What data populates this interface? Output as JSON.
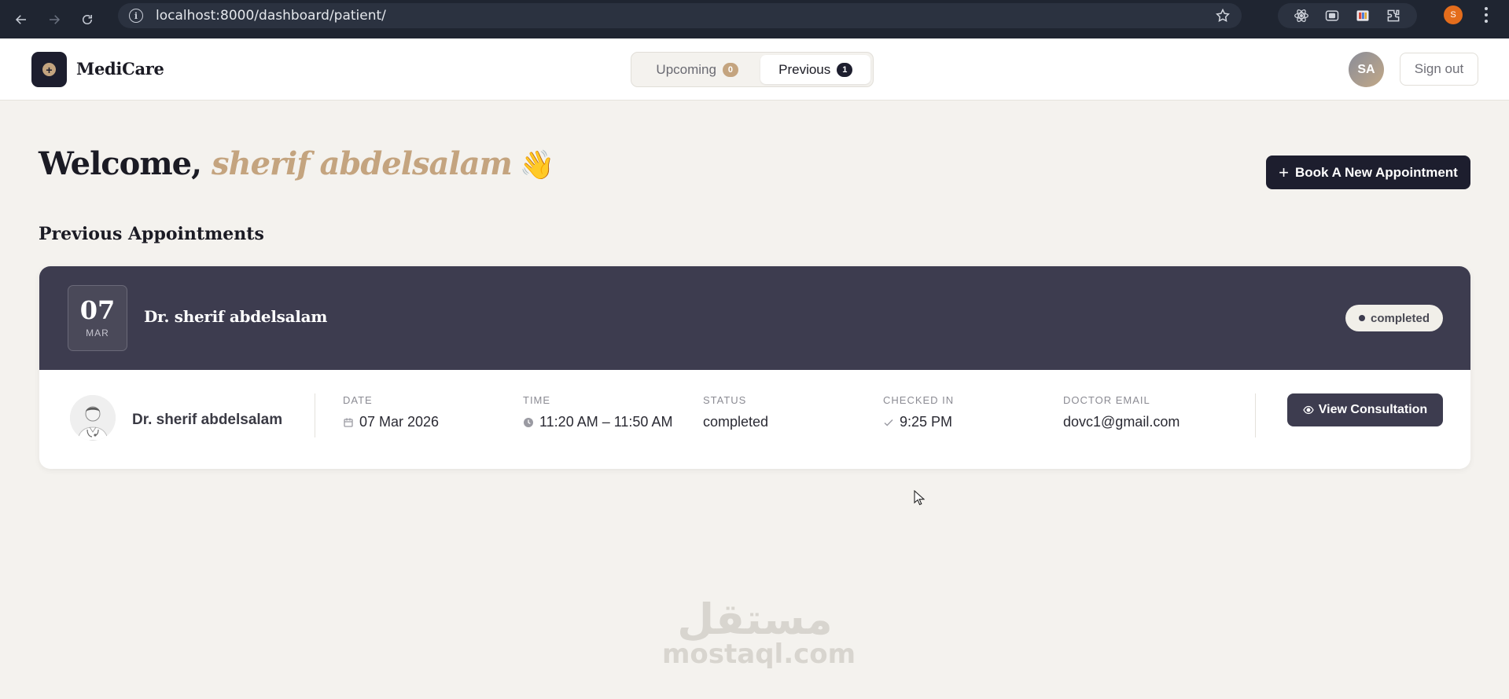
{
  "browser": {
    "url": "localhost:8000/dashboard/patient/",
    "profile_initial": "S",
    "icons": [
      "back-icon",
      "forward-icon",
      "reload-icon",
      "site-info-icon",
      "bookmark-star-icon",
      "react-devtools-icon",
      "screen-capture-icon",
      "extension-icon",
      "puzzle-icon",
      "menu-icon"
    ]
  },
  "header": {
    "brand": "MediCare",
    "tabs": [
      {
        "label": "Upcoming",
        "count": "0",
        "active": false
      },
      {
        "label": "Previous",
        "count": "1",
        "active": true
      }
    ],
    "avatar_initials": "SA",
    "signout_label": "Sign out"
  },
  "main": {
    "welcome_prefix": "Welcome,",
    "welcome_name": "sherif abdelsalam",
    "welcome_emoji": "👋",
    "book_button_label": "Book A New Appointment",
    "section_title": "Previous Appointments"
  },
  "appointment": {
    "day": "07",
    "month": "MAR",
    "doctor_name": "Dr. sherif abdelsalam",
    "status_badge": "completed",
    "fields": {
      "date_label": "DATE",
      "date_value": "07 Mar 2026",
      "time_label": "TIME",
      "time_value": "11:20 AM – 11:50 AM",
      "status_label": "STATUS",
      "status_value": "completed",
      "checked_in_label": "CHECKED IN",
      "checked_in_value": "9:25 PM",
      "email_label": "DOCTOR EMAIL",
      "email_value": "dovc1@gmail.com"
    },
    "view_button_label": "View Consultation"
  },
  "watermark": {
    "arabic": "مستقل",
    "latin": "mostaql.com"
  },
  "colors": {
    "accent_gold": "#c4a47f",
    "dark_navy": "#1d1e2e",
    "card_header": "#3d3c4f",
    "page_bg": "#f4f2ee"
  }
}
